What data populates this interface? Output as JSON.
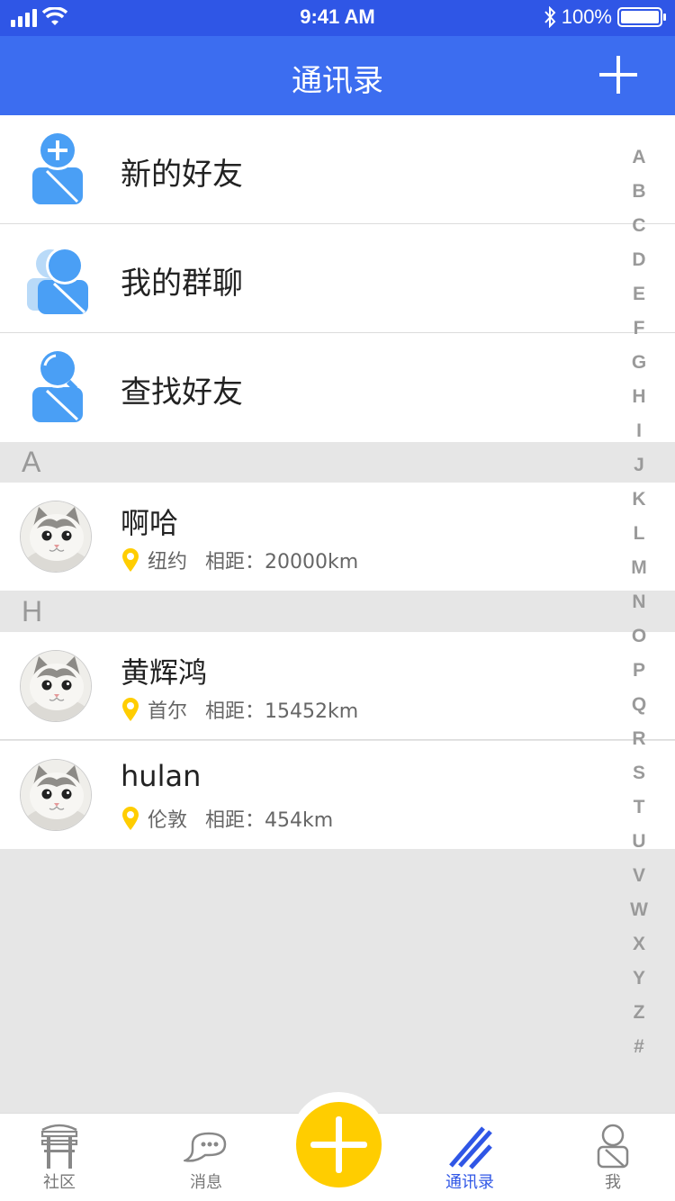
{
  "status_bar": {
    "time": "9:41 AM",
    "battery": "100%",
    "battery_level": 1.0
  },
  "header": {
    "title": "通讯录",
    "add_icon": "plus-icon"
  },
  "features": [
    {
      "label": "新的好友",
      "icon": "add-friend-icon"
    },
    {
      "label": "我的群聊",
      "icon": "group-chat-icon"
    },
    {
      "label": "查找好友",
      "icon": "search-friend-icon"
    }
  ],
  "sections": [
    {
      "letter": "A",
      "contacts": [
        {
          "name": "啊哈",
          "city": "纽约",
          "distance": "相距：20000km"
        }
      ]
    },
    {
      "letter": "H",
      "contacts": [
        {
          "name": "黄辉鸿",
          "city": "首尔",
          "distance": "相距：15452km"
        },
        {
          "name": "hulan",
          "city": "伦敦",
          "distance": "相距：454km"
        }
      ]
    }
  ],
  "alphabet": [
    "A",
    "B",
    "C",
    "D",
    "E",
    "F",
    "G",
    "H",
    "I",
    "J",
    "K",
    "L",
    "M",
    "N",
    "O",
    "P",
    "Q",
    "R",
    "S",
    "T",
    "U",
    "V",
    "W",
    "X",
    "Y",
    "Z",
    "#"
  ],
  "tab_bar": {
    "tabs": [
      {
        "label": "社区",
        "icon": "community-icon"
      },
      {
        "label": "消息",
        "icon": "message-icon"
      },
      {
        "label": "通讯录",
        "icon": "contacts-icon",
        "active": true
      },
      {
        "label": "我",
        "icon": "profile-icon"
      }
    ],
    "center_icon": "plus-icon"
  },
  "colors": {
    "primary": "#3c6df0",
    "status_bar": "#2f56e6",
    "accent": "#ffcd00",
    "icon_blue": "#4a9ff5",
    "background": "#e6e6e6"
  }
}
